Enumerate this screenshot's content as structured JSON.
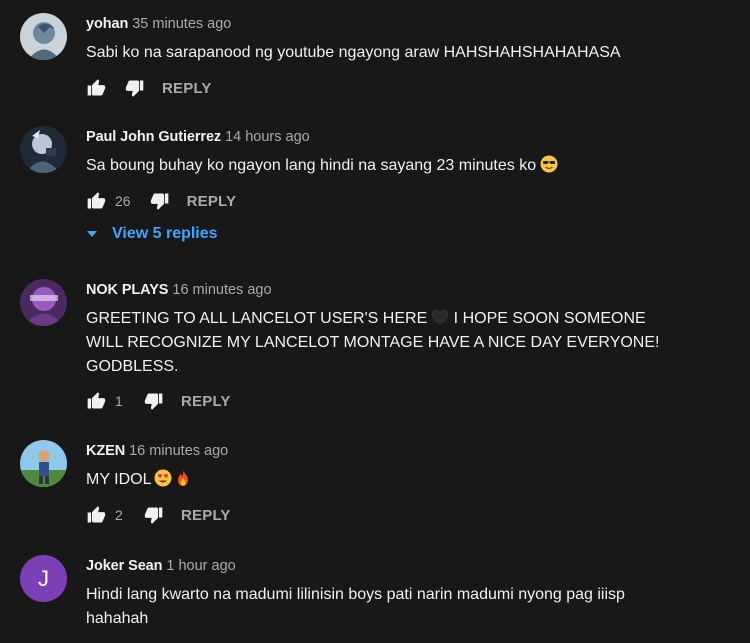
{
  "comments": [
    {
      "author": "yohan",
      "time": "35 minutes ago",
      "text": "Sabi ko na sarapanood ng youtube ngayong araw HAHSHAHSHAHAHASA",
      "likes": "",
      "reply_label": "REPLY"
    },
    {
      "author": "Paul John Gutierrez",
      "time": "14 hours ago",
      "text": "Sa boung buhay ko ngayon lang hindi na sayang 23 minutes ko",
      "likes": "26",
      "reply_label": "REPLY",
      "view_replies_label": "View 5 replies"
    },
    {
      "author": "NOK PLAYS",
      "time": "16 minutes ago",
      "text_part1": "GREETING TO ALL LANCELOT USER'S HERE",
      "text_part2": " I HOPE SOON SOMEONE WILL RECOGNIZE MY LANCELOT MONTAGE HAVE A NICE DAY EVERYONE! GODBLESS.",
      "likes": "1",
      "reply_label": "REPLY"
    },
    {
      "author": "KZEN",
      "time": "16 minutes ago",
      "text": "MY IDOL",
      "likes": "2",
      "reply_label": "REPLY"
    },
    {
      "author": "Joker Sean",
      "time": "1 hour ago",
      "avatar_letter": "J",
      "text": "Hindi lang kwarto na madumi lilinisin boys pati narin madumi nyong pag iiisp hahahah"
    }
  ],
  "icons": [
    "thumb-up-icon",
    "thumb-down-icon",
    "caret-down-icon",
    "smiling-face-with-sunglasses",
    "black-heart",
    "smiling-face-with-heart-eyes",
    "fire"
  ],
  "colors": {
    "background": "#181818",
    "link": "#3ea6ff",
    "muted": "#aaaaaa",
    "joker_avatar": "#7c3fb5"
  }
}
